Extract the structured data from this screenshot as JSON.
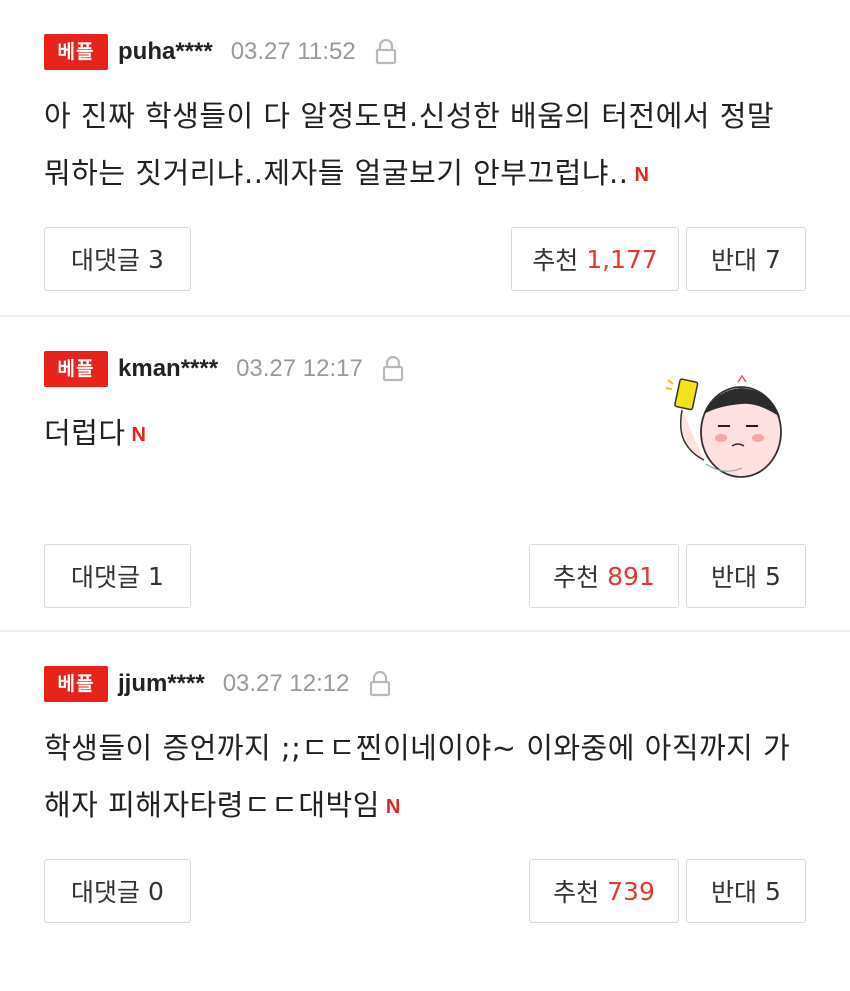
{
  "comments": [
    {
      "badge": "베플",
      "user": "puha****",
      "time": "03.27 11:52",
      "text": "아 진짜 학생들이 다 알정도면.신성한 배움의 터전에서 정말 뭐하는 짓거리냐..제자들 얼굴보기 안부끄럽냐..",
      "new_mark": "N",
      "reply_label": "대댓글",
      "reply_count": "3",
      "recommend_label": "추천",
      "recommend_count": "1,177",
      "oppose_label": "반대",
      "oppose_count": "7"
    },
    {
      "badge": "베플",
      "user": "kman****",
      "time": "03.27 12:17",
      "text": "더럽다",
      "new_mark": "N",
      "reply_label": "대댓글",
      "reply_count": "1",
      "recommend_label": "추천",
      "recommend_count": "891",
      "oppose_label": "반대",
      "oppose_count": "5"
    },
    {
      "badge": "베플",
      "user": "jjum****",
      "time": "03.27 12:12",
      "text": "학생들이 증언까지 ;;ㄷㄷ찐이네이야~ 이와중에 아직까지 가해자 피해자타령ㄷㄷ대박임",
      "new_mark": "N",
      "reply_label": "대댓글",
      "reply_count": "0",
      "recommend_label": "추천",
      "recommend_count": "739",
      "oppose_label": "반대",
      "oppose_count": "5"
    }
  ],
  "colors": {
    "badge": "#e8231c",
    "recommend_count": "#e33a30",
    "time": "#9a9a9a",
    "divider": "#eeeeee"
  },
  "icons": {
    "lock": "lock-icon",
    "sticker": "sticker-avatar"
  }
}
